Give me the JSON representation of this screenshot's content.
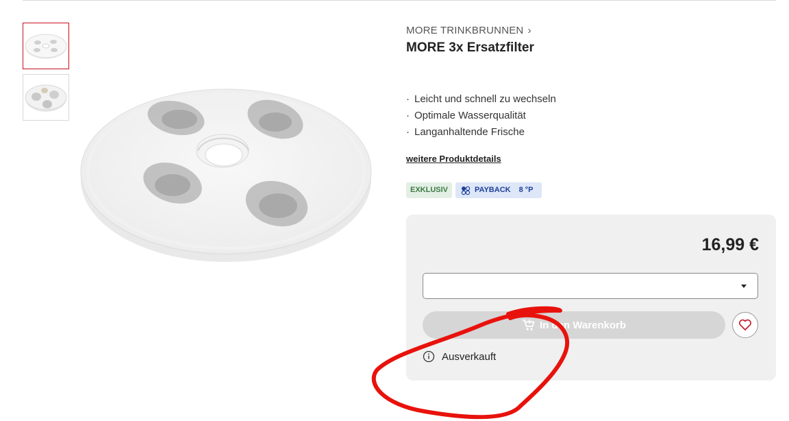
{
  "gallery": {
    "thumbnails": [
      {
        "name": "thumbnail-filter-top",
        "active": true
      },
      {
        "name": "thumbnail-filter-angle",
        "active": false
      }
    ]
  },
  "breadcrumb": {
    "label": "MORE TRINKBRUNNEN",
    "separator": "›"
  },
  "product": {
    "title": "MORE 3x Ersatzfilter",
    "features": [
      "Leicht und schnell zu wechseln",
      "Optimale Wasserqualität",
      "Langanhaltende Frische"
    ],
    "details_link": "weitere Produktdetails"
  },
  "badges": {
    "exklusiv": "EXKLUSIV",
    "payback_label": "PAYBACK",
    "payback_points": "8 °P"
  },
  "buy_box": {
    "price": "16,99 €",
    "variant_select_value": "",
    "cart_button_label": "In den Warenkorb",
    "status": "Ausverkauft"
  },
  "colors": {
    "accent_red": "#c4101e",
    "exklusiv_green": "#3c7a44",
    "payback_blue": "#1f3f99",
    "annotation_red": "#e8120c"
  },
  "icons": [
    "cart-icon",
    "heart-icon",
    "info-icon",
    "payback-icon",
    "chevron-down-icon"
  ]
}
